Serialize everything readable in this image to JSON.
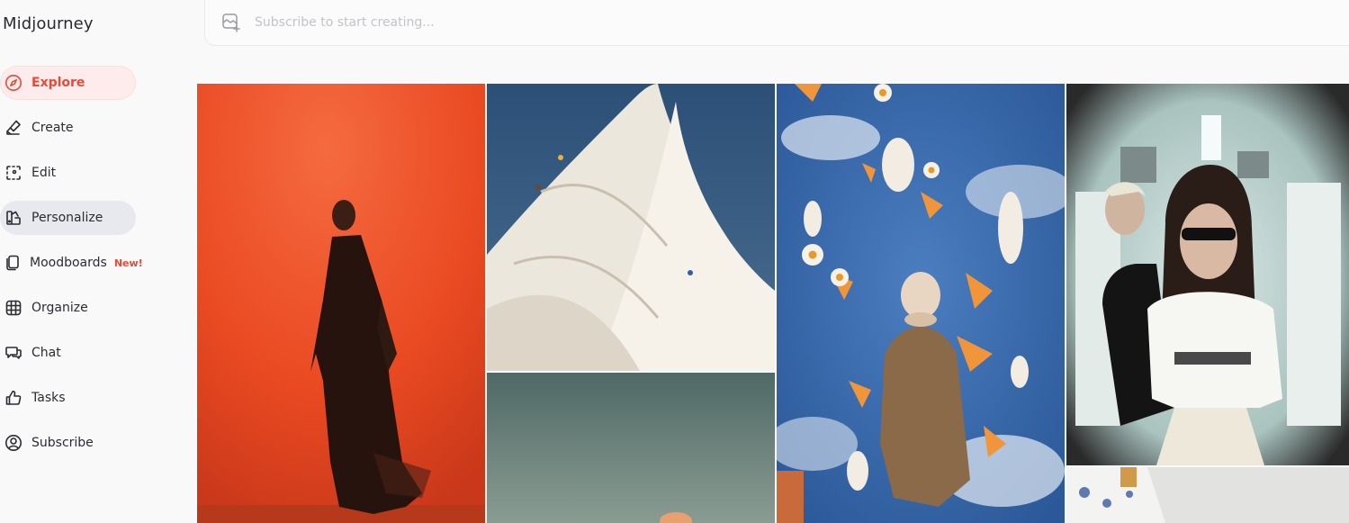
{
  "app": {
    "title": "Midjourney"
  },
  "sidebar": {
    "items": [
      {
        "label": "Explore",
        "icon": "compass-icon"
      },
      {
        "label": "Create",
        "icon": "brush-icon"
      },
      {
        "label": "Edit",
        "icon": "edit-frame-icon"
      },
      {
        "label": "Personalize",
        "icon": "palette-icon"
      },
      {
        "label": "Moodboards",
        "icon": "moodboard-icon",
        "badge": "New!"
      },
      {
        "label": "Organize",
        "icon": "grid-icon"
      },
      {
        "label": "Chat",
        "icon": "chat-icon"
      },
      {
        "label": "Tasks",
        "icon": "thumbs-up-icon"
      },
      {
        "label": "Subscribe",
        "icon": "user-circle-icon"
      }
    ]
  },
  "prompt_bar": {
    "placeholder": "Subscribe to start creating..."
  },
  "colors": {
    "accent": "#e94a35",
    "active_bg": "#fdeceb",
    "selected_bg": "#e8e9ef"
  },
  "gallery": {
    "images": [
      {
        "name": "man-walking-orange-wall"
      },
      {
        "name": "whipped-cream-climbers"
      },
      {
        "name": "flying-petals-fisheye"
      },
      {
        "name": "subway-fisheye-portrait"
      },
      {
        "name": "teal-gradient-scene"
      },
      {
        "name": "porcelain-vase-partial"
      }
    ]
  }
}
